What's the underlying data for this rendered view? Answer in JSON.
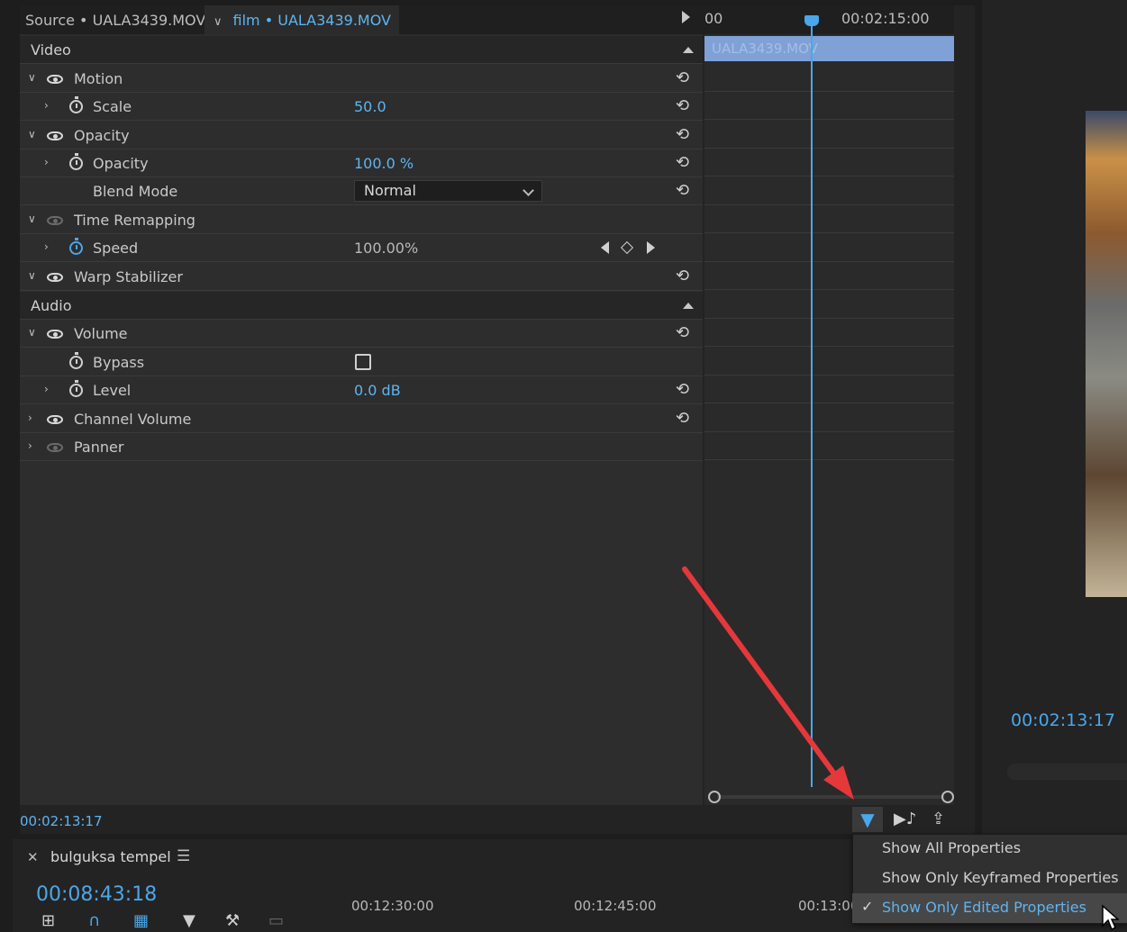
{
  "tabs": {
    "source": "Source • UALA3439.MOV",
    "film": "film • UALA3439.MOV"
  },
  "sections": {
    "video": "Video",
    "audio": "Audio"
  },
  "effects": {
    "motion": "Motion",
    "scale_label": "Scale",
    "scale_value": "50.0",
    "opacity_group": "Opacity",
    "opacity_label": "Opacity",
    "opacity_value": "100.0 %",
    "blend_label": "Blend Mode",
    "blend_value": "Normal",
    "time_remapping": "Time Remapping",
    "speed_label": "Speed",
    "speed_value": "100.00%",
    "warp": "Warp Stabilizer",
    "volume": "Volume",
    "bypass_label": "Bypass",
    "level_label": "Level",
    "level_value": "0.0 dB",
    "channel_volume": "Channel Volume",
    "panner": "Panner"
  },
  "mini_timeline": {
    "ruler_left": "00",
    "ruler_time": "00:02:15:00",
    "clip_name": "UALA3439.MOV"
  },
  "ec_timecode": "00:02:13:17",
  "program": {
    "timecode": "00:02:13:17"
  },
  "timeline": {
    "sequence_name": "bulguksa tempel",
    "timecode": "00:08:43:18",
    "ruler": [
      "00:12:30:00",
      "00:12:45:00",
      "00:13:00"
    ]
  },
  "popup_menu": {
    "items": [
      "Show All Properties",
      "Show Only Keyframed Properties",
      "Show Only Edited Properties"
    ],
    "selected_index": 2
  },
  "colors": {
    "accent": "#4aa7ea",
    "annotation_arrow": "#e5383b"
  }
}
